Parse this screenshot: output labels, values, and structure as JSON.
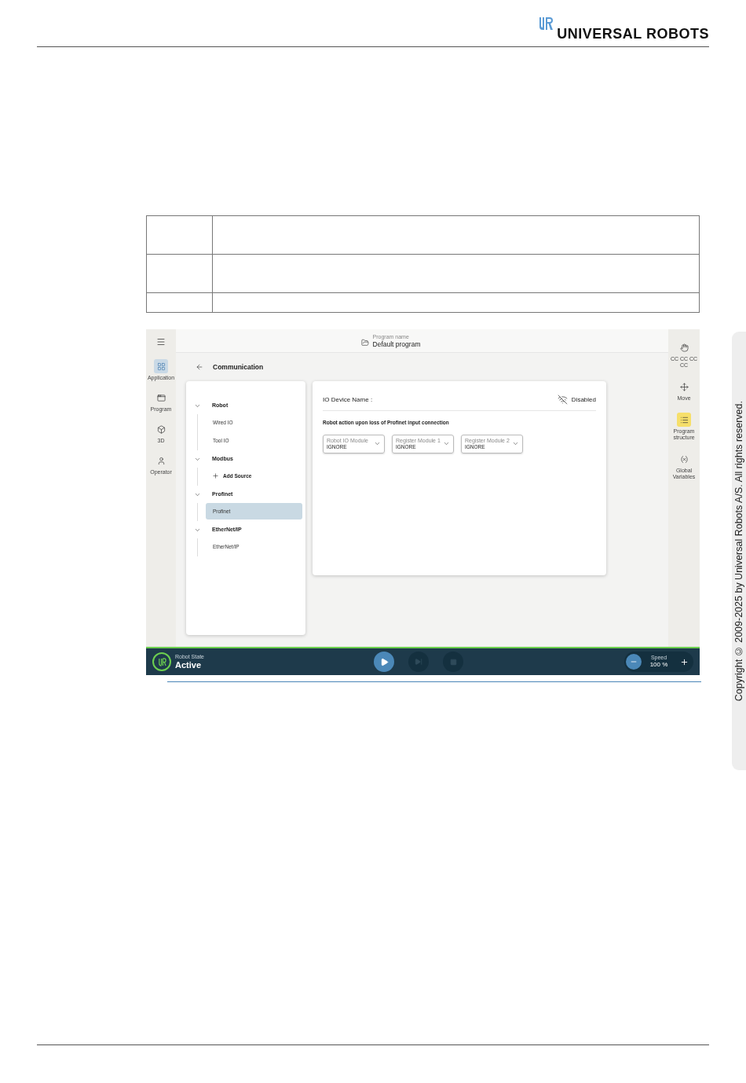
{
  "header": {
    "logo_text": "UNIVERSAL ROBOTS"
  },
  "app": {
    "left_nav": [
      {
        "label": "Application",
        "selected": true
      },
      {
        "label": "Program",
        "selected": false
      },
      {
        "label": "3D",
        "selected": false
      },
      {
        "label": "Operator",
        "selected": false
      }
    ],
    "program": {
      "caption": "Program name",
      "name": "Default program"
    },
    "page_title": "Communication",
    "tree": [
      {
        "label": "Robot",
        "expanded": true,
        "children": [
          {
            "label": "Wired IO",
            "kind": "item",
            "selected": false
          },
          {
            "label": "Tool IO",
            "kind": "item",
            "selected": false
          }
        ]
      },
      {
        "label": "Modbus",
        "expanded": true,
        "children": [
          {
            "label": "Add Source",
            "kind": "add",
            "selected": false
          }
        ]
      },
      {
        "label": "Profinet",
        "expanded": true,
        "children": [
          {
            "label": "Profinet",
            "kind": "item",
            "selected": true
          }
        ]
      },
      {
        "label": "EtherNet/IP",
        "expanded": true,
        "children": [
          {
            "label": "EtherNet/IP",
            "kind": "item",
            "selected": false
          }
        ]
      }
    ],
    "device": {
      "label": "IO Device Name :",
      "status": "Disabled"
    },
    "section_title": "Robot action upon loss of Profinet input connection",
    "dropdowns": [
      {
        "label": "Robot IO Module",
        "value": "IGNORE"
      },
      {
        "label": "Register Module 1",
        "value": "IGNORE"
      },
      {
        "label": "Register Module 2",
        "value": "IGNORE"
      }
    ],
    "right_nav": [
      {
        "label": "CC CC CC CC",
        "selected": false
      },
      {
        "label": "Move",
        "selected": false
      },
      {
        "label": "Program structure",
        "selected": true
      },
      {
        "label": "Global Variables",
        "selected": false
      }
    ],
    "status_bar": {
      "caption": "Robot State",
      "state": "Active",
      "speed_caption": "Speed",
      "speed": "100 %"
    }
  },
  "side_tab": "Copyright © 2009-2025 by Universal Robots A/S. All rights reserved."
}
